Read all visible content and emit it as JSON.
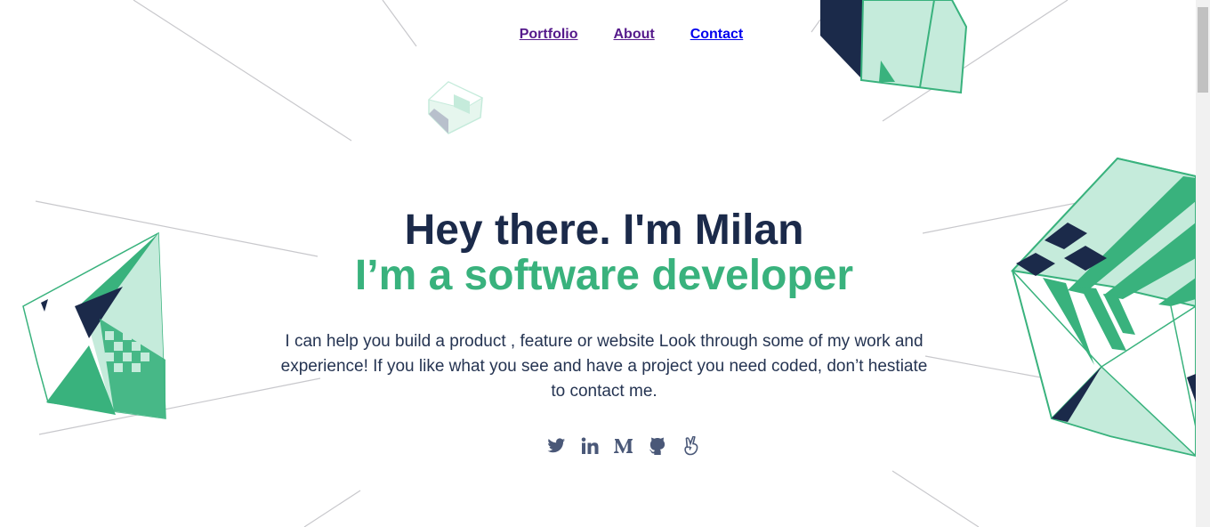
{
  "nav": {
    "items": [
      {
        "label": "Portfolio"
      },
      {
        "label": "About"
      },
      {
        "label": "Contact"
      }
    ]
  },
  "hero": {
    "heading": "Hey there. I'm Milan",
    "subheading": "I’m a software developer",
    "description": "I can help you build a product , feature or website Look through some of my work and experience! If you like what you see and have a project you need coded, don’t hestiate to contact me."
  },
  "social": [
    "twitter-icon",
    "linkedin-icon",
    "medium-icon",
    "github-icon",
    "angellist-icon"
  ],
  "colors": {
    "navy": "#1b2a4a",
    "green": "#39b27d",
    "mint": "#c5ebdb",
    "line": "#c8c8cc"
  }
}
